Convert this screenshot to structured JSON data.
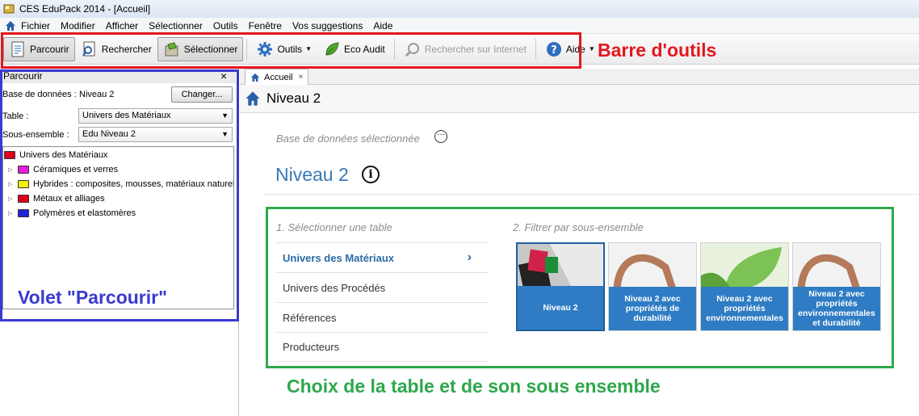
{
  "window": {
    "title": "CES EduPack 2014 - [Accueil]"
  },
  "menu": [
    "Fichier",
    "Modifier",
    "Afficher",
    "Sélectionner",
    "Outils",
    "Fenêtre",
    "Vos suggestions",
    "Aide"
  ],
  "toolbar": {
    "parcourir": "Parcourir",
    "rechercher": "Rechercher",
    "selectionner": "Sélectionner",
    "outils": "Outils",
    "eco_audit": "Eco Audit",
    "internet": "Rechercher sur Internet",
    "aide": "Aide"
  },
  "annotations": {
    "toolbar": "Barre d'outils",
    "browse_pane": "Volet \"Parcourir\"",
    "table_choice": "Choix de la table et de son sous ensemble"
  },
  "browse": {
    "title": "Parcourir",
    "close": "×",
    "db_label": "Base de données :",
    "db_value": "Niveau 2",
    "change_button": "Changer...",
    "table_label": "Table :",
    "table_value": "Univers des Matériaux",
    "subset_label": "Sous-ensemble :",
    "subset_value": "Edu Niveau 2",
    "tree": [
      {
        "label": "Univers des Matériaux",
        "color": "#e0001b"
      },
      {
        "label": "Céramiques et verres",
        "color": "#e71de0"
      },
      {
        "label": "Hybrides : composites, mousses, matériaux naturels",
        "color": "#f4ee00"
      },
      {
        "label": "Métaux et alliages",
        "color": "#e0001b"
      },
      {
        "label": "Polymères et elastomères",
        "color": "#1f24d4"
      }
    ]
  },
  "tab": {
    "label": "Accueil",
    "close": "×"
  },
  "crumb": {
    "title": "Niveau 2"
  },
  "home": {
    "db_selected_label": "Base de données sélectionnée",
    "db_name": "Niveau 2",
    "section1": "1. Sélectionner une table",
    "section2": "2. Filtrer par sous-ensemble",
    "tables": [
      "Univers des Matériaux",
      "Univers des Procédés",
      "Références",
      "Producteurs"
    ],
    "subsets": [
      "Niveau 2",
      "Niveau 2 avec propriétés de durabilité",
      "Niveau 2 avec propriétés environnementales",
      "Niveau 2 avec propriétés environnementales et durabilité"
    ]
  },
  "colors": {
    "accent": "#3779b8",
    "tile_caption": "#2f7cc4",
    "red_annot": "#e3171d",
    "blue_annot": "#3a3ad0",
    "green_annot": "#2ea84c"
  }
}
